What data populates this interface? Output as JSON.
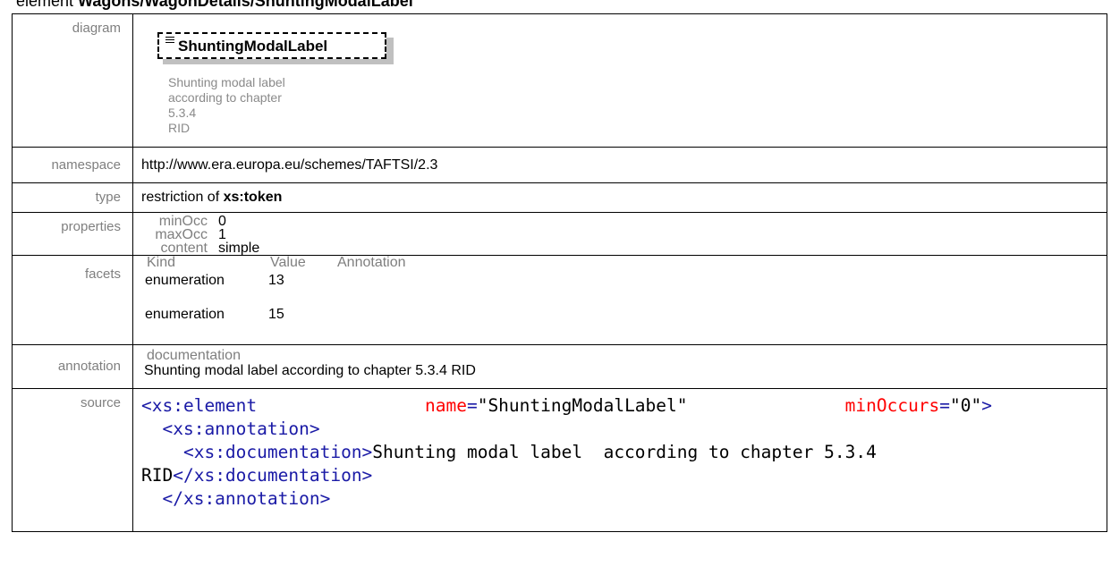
{
  "heading": {
    "prefix": "element ",
    "path": "Wagons/WagonDetails/ShuntingModalLabel"
  },
  "labels": {
    "diagram": "diagram",
    "namespace": "namespace",
    "type": "type",
    "properties": "properties",
    "facets": "facets",
    "annotation": "annotation",
    "source": "source"
  },
  "diagram": {
    "element_name": "ShuntingModalLabel",
    "doc_lines": [
      "Shunting modal label",
      "according to chapter 5.3.4",
      "RID"
    ]
  },
  "namespace": "http://www.era.europa.eu/schemes/TAFTSI/2.3",
  "type": {
    "prefix": "restriction of ",
    "base": "xs:token"
  },
  "properties": [
    {
      "key": "minOcc",
      "value": "0"
    },
    {
      "key": "maxOcc",
      "value": "1"
    },
    {
      "key": "content",
      "value": "simple"
    }
  ],
  "facets": {
    "headers": [
      "Kind",
      "Value",
      "Annotation"
    ],
    "rows": [
      {
        "kind": "enumeration",
        "value": "13"
      },
      {
        "kind": "enumeration",
        "value": "15"
      }
    ]
  },
  "annotation": {
    "head": "documentation",
    "text": "Shunting modal label  according to chapter 5.3.4 RID"
  },
  "source": {
    "l1_tag": "<xs:element",
    "l1_attr1": "name",
    "l1_eq1": "=",
    "l1_val1": "\"ShuntingModalLabel\"",
    "l1_attr2": "minOccurs",
    "l1_eq2": "=",
    "l1_val2": "\"0\"",
    "l1_close": ">",
    "l2": "<xs:annotation>",
    "l3_open": "<xs:documentation>",
    "l3_text": "Shunting modal label  according to chapter 5.3.4",
    "l4_text": "RID",
    "l4_close": "</xs:documentation>",
    "l5": "</xs:annotation>"
  },
  "colors": {
    "label_gray": "#7f7f7f",
    "tag_blue": "#1a1aa6",
    "attr_red": "#ff0000",
    "value_blue": "#0000ff"
  }
}
